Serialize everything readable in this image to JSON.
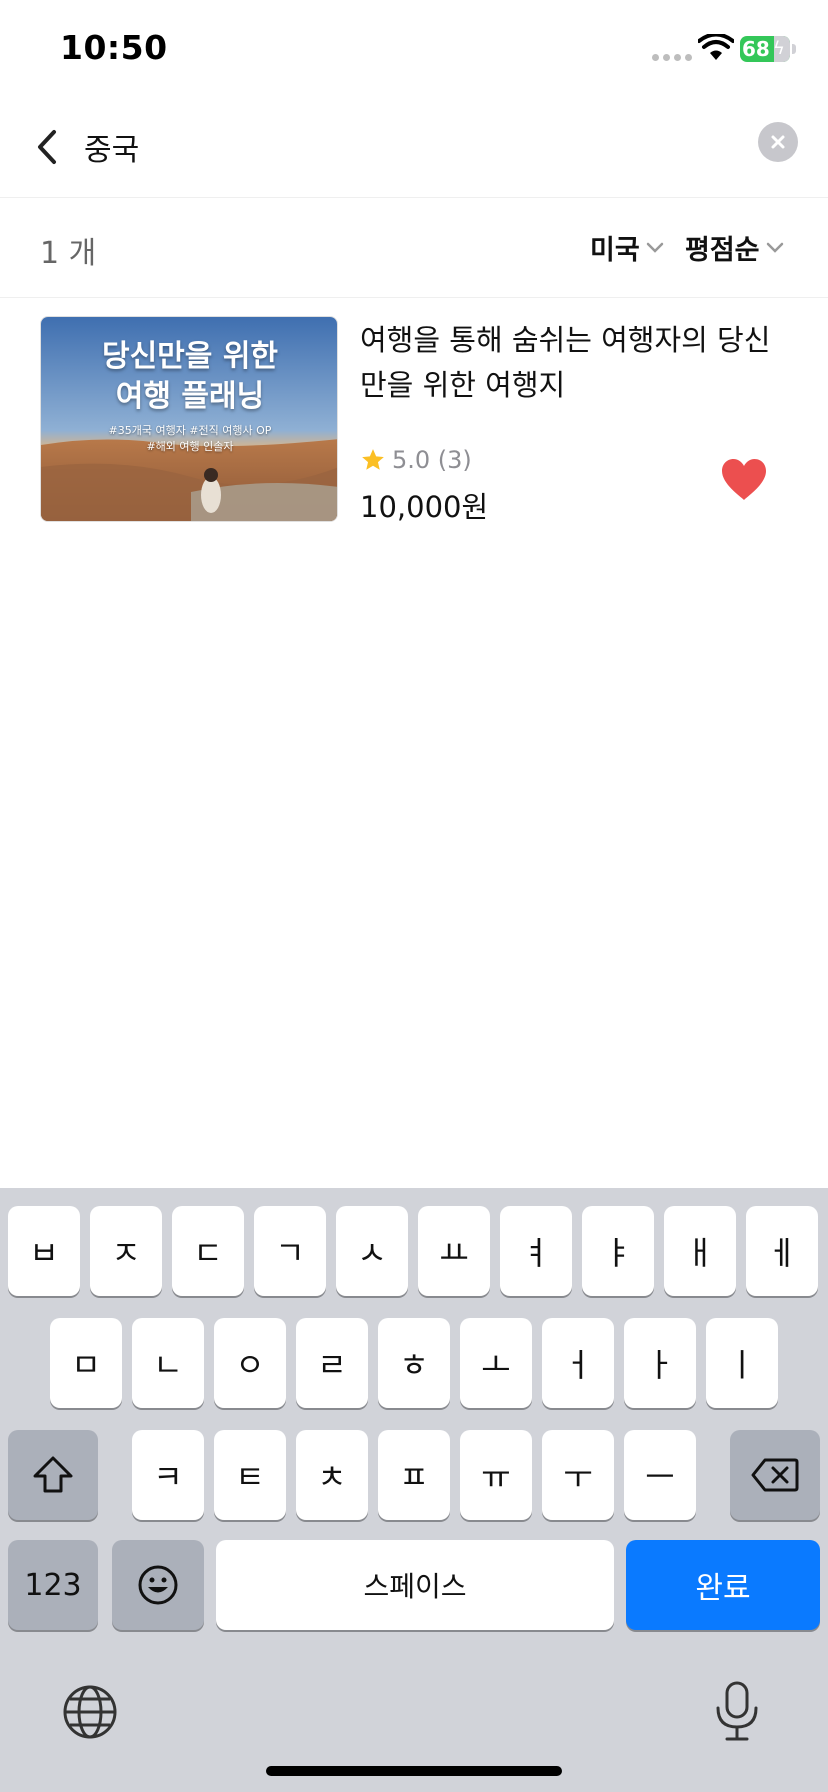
{
  "status_bar": {
    "time": "10:50",
    "battery_percent": "68",
    "battery_level": 0.68,
    "battery_color": "#34c759",
    "icons": [
      "cellular-dots-icon",
      "wifi-icon",
      "battery-charging-icon"
    ]
  },
  "search": {
    "query": "중국",
    "back_icon": "chevron-left-icon",
    "clear_icon": "clear-circle-icon"
  },
  "filters": {
    "result_count": "1 개",
    "country_label": "미국",
    "sort_label": "평점순",
    "dropdown_icon": "chevron-down-icon"
  },
  "results": [
    {
      "thumbnail": {
        "headline_line1": "당신만을 위한",
        "headline_line2": "여행 플래닝",
        "tags_line1": "#35개국 여행자 #전직 여행사 OP",
        "tags_line2": "#해외 여행 인솔자"
      },
      "title": "여행을 통해 숨쉬는 여행자의 당신만을 위한 여행지",
      "rating": "5.0 (3)",
      "rating_icon": "star-icon",
      "star_color": "#fbbf24",
      "price": "10,000원",
      "favorite_icon": "heart-icon",
      "favorite_color": "#ec4f4f",
      "favorited": true
    }
  ],
  "keyboard": {
    "row1": [
      "ㅂ",
      "ㅈ",
      "ㄷ",
      "ㄱ",
      "ㅅ",
      "ㅛ",
      "ㅕ",
      "ㅑ",
      "ㅐ",
      "ㅔ"
    ],
    "row2": [
      "ㅁ",
      "ㄴ",
      "ㅇ",
      "ㄹ",
      "ㅎ",
      "ㅗ",
      "ㅓ",
      "ㅏ",
      "ㅣ"
    ],
    "row3": [
      "ㅋ",
      "ㅌ",
      "ㅊ",
      "ㅍ",
      "ㅠ",
      "ㅜ",
      "ㅡ"
    ],
    "numbers_label": "123",
    "space_label": "스페이스",
    "done_label": "완료",
    "accent_color": "#0a7aff",
    "icons": [
      "shift-icon",
      "backspace-icon",
      "emoji-icon",
      "globe-icon",
      "microphone-icon"
    ]
  }
}
